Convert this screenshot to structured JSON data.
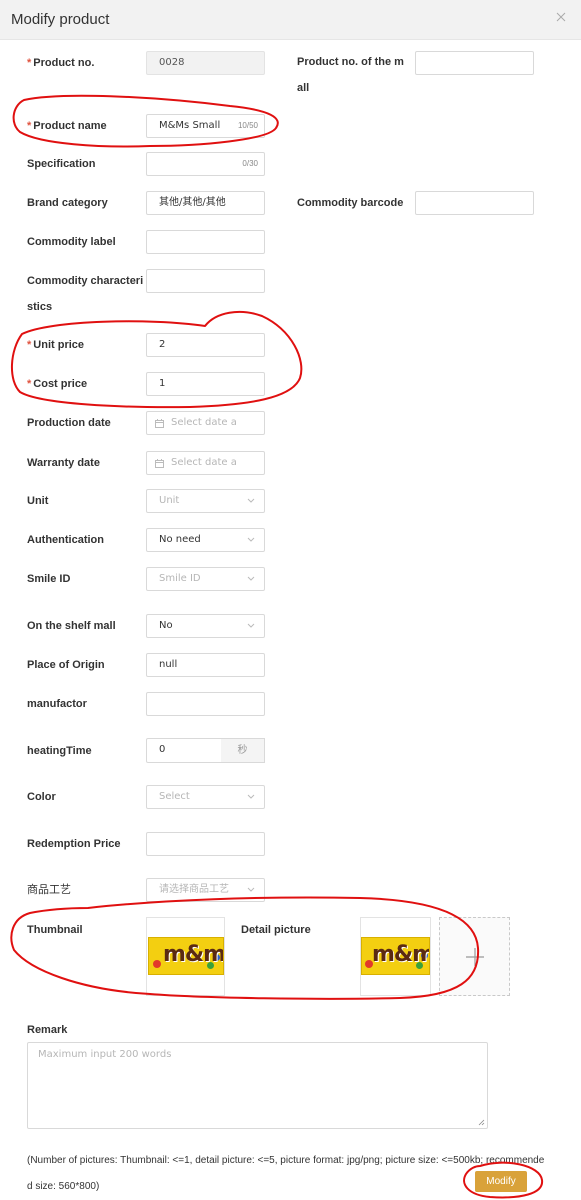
{
  "dialog": {
    "title": "Modify product"
  },
  "fields": {
    "product_no": {
      "label": "Product no.",
      "value": "0028"
    },
    "mall_product_no": {
      "label": "Product no. of the mall",
      "value": ""
    },
    "product_name": {
      "label": "Product name",
      "value": "M&Ms Small",
      "counter": "10/50"
    },
    "specification": {
      "label": "Specification",
      "value": "",
      "counter": "0/30"
    },
    "brand_category": {
      "label": "Brand category",
      "value": "其他/其他/其他"
    },
    "commodity_barcode": {
      "label": "Commodity barcode",
      "value": ""
    },
    "commodity_label": {
      "label": "Commodity label",
      "value": ""
    },
    "commodity_characteristics": {
      "label": "Commodity characteristics",
      "value": ""
    },
    "unit_price": {
      "label": "Unit price",
      "value": "2"
    },
    "cost_price": {
      "label": "Cost price",
      "value": "1"
    },
    "production_date": {
      "label": "Production date",
      "placeholder": "Select date a"
    },
    "warranty_date": {
      "label": "Warranty date",
      "placeholder": "Select date a"
    },
    "unit": {
      "label": "Unit",
      "placeholder": "Unit"
    },
    "authentication": {
      "label": "Authentication",
      "value": "No need"
    },
    "smile_id": {
      "label": "Smile ID",
      "placeholder": "Smile ID"
    },
    "on_shelf_mall": {
      "label": "On the shelf mall",
      "value": "No"
    },
    "place_of_origin": {
      "label": "Place of Origin",
      "value": "null"
    },
    "manufactor": {
      "label": "manufactor",
      "value": ""
    },
    "heating_time": {
      "label": "heatingTime",
      "value": "0",
      "suffix": "秒"
    },
    "color": {
      "label": "Color",
      "placeholder": "Select"
    },
    "redemption_price": {
      "label": "Redemption Price",
      "value": ""
    },
    "craft": {
      "label": "商品工艺",
      "placeholder": "请选择商品工艺"
    },
    "thumbnail": {
      "label": "Thumbnail",
      "image": "m&m's"
    },
    "detail_picture": {
      "label": "Detail picture",
      "image": "m&m's"
    },
    "remark": {
      "label": "Remark",
      "placeholder": "Maximum input 200 words"
    }
  },
  "note": "(Number of pictures: Thumbnail: <=1, detail picture: <=5, picture format: jpg/png; picture size: <=500kb; recommended size: 560*800)",
  "buttons": {
    "modify": "Modify"
  },
  "icons": {
    "close": "close-icon",
    "calendar": "calendar-icon",
    "chevron": "chevron-down-icon",
    "add": "plus-icon"
  },
  "colors": {
    "accent": "#d9a23a",
    "required": "#e0533f",
    "annotation": "#e01010"
  }
}
